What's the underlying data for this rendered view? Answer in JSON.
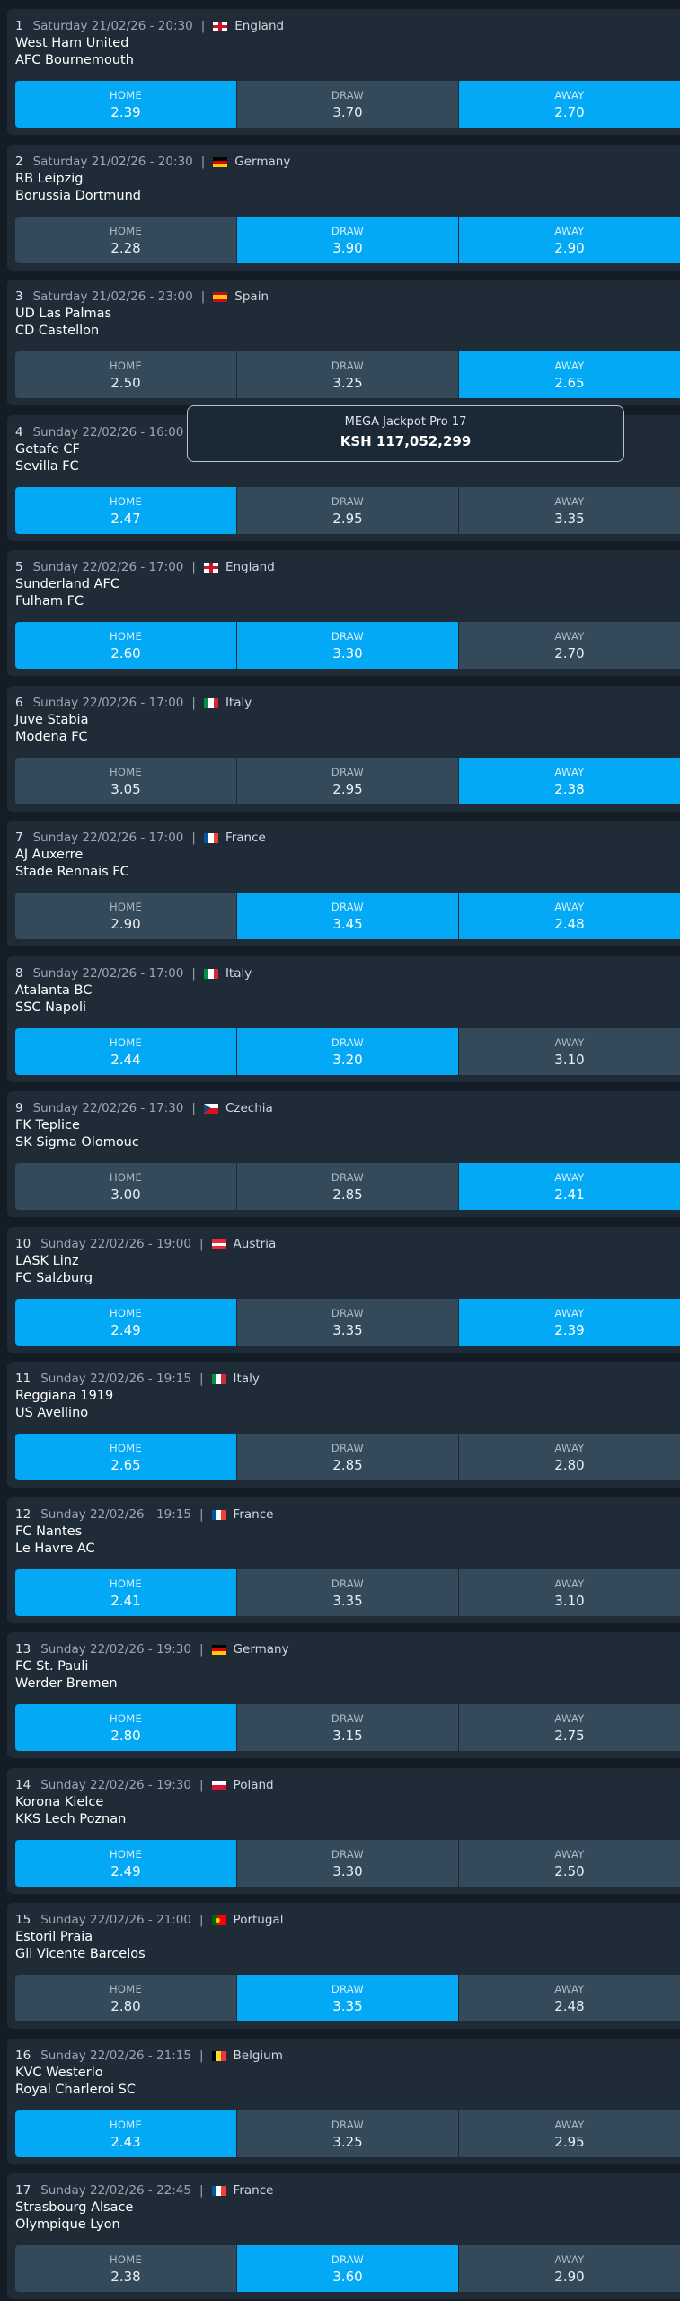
{
  "jackpot": {
    "title": "MEGA Jackpot Pro 17",
    "amount": "KSH 117,052,299"
  },
  "odds_labels": {
    "home": "HOME",
    "draw": "DRAW",
    "away": "AWAY"
  },
  "colors": {
    "selected": "#03a9f4",
    "unselected": "#34495a",
    "card": "#1f2c38",
    "background": "#141d26"
  },
  "matches": [
    {
      "num": "1",
      "date": "Saturday 21/02/26 - 20:30",
      "country": "England",
      "flag": "england-flag-icon",
      "home_team": "West Ham United",
      "away_team": "AFC Bournemouth",
      "odds": {
        "home": "2.39",
        "draw": "3.70",
        "away": "2.70"
      },
      "selected": [
        "home",
        "away"
      ]
    },
    {
      "num": "2",
      "date": "Saturday 21/02/26 - 20:30",
      "country": "Germany",
      "flag": "germany-flag-icon",
      "home_team": "RB Leipzig",
      "away_team": "Borussia Dortmund",
      "odds": {
        "home": "2.28",
        "draw": "3.90",
        "away": "2.90"
      },
      "selected": [
        "draw",
        "away"
      ]
    },
    {
      "num": "3",
      "date": "Saturday 21/02/26 - 23:00",
      "country": "Spain",
      "flag": "spain-flag-icon",
      "home_team": "UD Las Palmas",
      "away_team": "CD Castellon",
      "odds": {
        "home": "2.50",
        "draw": "3.25",
        "away": "2.65"
      },
      "selected": [
        "away"
      ]
    },
    {
      "num": "4",
      "date": "Sunday 22/02/26 - 16:00",
      "country": "",
      "flag": "",
      "home_team": "Getafe CF",
      "away_team": "Sevilla FC",
      "odds": {
        "home": "2.47",
        "draw": "2.95",
        "away": "3.35"
      },
      "selected": [
        "home"
      ]
    },
    {
      "num": "5",
      "date": "Sunday 22/02/26 - 17:00",
      "country": "England",
      "flag": "england-flag-icon",
      "home_team": "Sunderland AFC",
      "away_team": "Fulham FC",
      "odds": {
        "home": "2.60",
        "draw": "3.30",
        "away": "2.70"
      },
      "selected": [
        "home",
        "draw"
      ]
    },
    {
      "num": "6",
      "date": "Sunday 22/02/26 - 17:00",
      "country": "Italy",
      "flag": "italy-flag-icon",
      "home_team": "Juve Stabia",
      "away_team": "Modena FC",
      "odds": {
        "home": "3.05",
        "draw": "2.95",
        "away": "2.38"
      },
      "selected": [
        "away"
      ]
    },
    {
      "num": "7",
      "date": "Sunday 22/02/26 - 17:00",
      "country": "France",
      "flag": "france-flag-icon",
      "home_team": "AJ Auxerre",
      "away_team": "Stade Rennais FC",
      "odds": {
        "home": "2.90",
        "draw": "3.45",
        "away": "2.48"
      },
      "selected": [
        "draw",
        "away"
      ]
    },
    {
      "num": "8",
      "date": "Sunday 22/02/26 - 17:00",
      "country": "Italy",
      "flag": "italy-flag-icon",
      "home_team": "Atalanta BC",
      "away_team": "SSC Napoli",
      "odds": {
        "home": "2.44",
        "draw": "3.20",
        "away": "3.10"
      },
      "selected": [
        "home",
        "draw"
      ]
    },
    {
      "num": "9",
      "date": "Sunday 22/02/26 - 17:30",
      "country": "Czechia",
      "flag": "czechia-flag-icon",
      "home_team": "FK Teplice",
      "away_team": "SK Sigma Olomouc",
      "odds": {
        "home": "3.00",
        "draw": "2.85",
        "away": "2.41"
      },
      "selected": [
        "away"
      ]
    },
    {
      "num": "10",
      "date": "Sunday 22/02/26 - 19:00",
      "country": "Austria",
      "flag": "austria-flag-icon",
      "home_team": "LASK Linz",
      "away_team": "FC Salzburg",
      "odds": {
        "home": "2.49",
        "draw": "3.35",
        "away": "2.39"
      },
      "selected": [
        "home",
        "away"
      ]
    },
    {
      "num": "11",
      "date": "Sunday 22/02/26 - 19:15",
      "country": "Italy",
      "flag": "italy-flag-icon",
      "home_team": "Reggiana 1919",
      "away_team": "US Avellino",
      "odds": {
        "home": "2.65",
        "draw": "2.85",
        "away": "2.80"
      },
      "selected": [
        "home"
      ]
    },
    {
      "num": "12",
      "date": "Sunday 22/02/26 - 19:15",
      "country": "France",
      "flag": "france-flag-icon",
      "home_team": "FC Nantes",
      "away_team": "Le Havre AC",
      "odds": {
        "home": "2.41",
        "draw": "3.35",
        "away": "3.10"
      },
      "selected": [
        "home"
      ]
    },
    {
      "num": "13",
      "date": "Sunday 22/02/26 - 19:30",
      "country": "Germany",
      "flag": "germany-flag-icon",
      "home_team": "FC St. Pauli",
      "away_team": "Werder Bremen",
      "odds": {
        "home": "2.80",
        "draw": "3.15",
        "away": "2.75"
      },
      "selected": [
        "home"
      ]
    },
    {
      "num": "14",
      "date": "Sunday 22/02/26 - 19:30",
      "country": "Poland",
      "flag": "poland-flag-icon",
      "home_team": "Korona Kielce",
      "away_team": "KKS Lech Poznan",
      "odds": {
        "home": "2.49",
        "draw": "3.30",
        "away": "2.50"
      },
      "selected": [
        "home"
      ]
    },
    {
      "num": "15",
      "date": "Sunday 22/02/26 - 21:00",
      "country": "Portugal",
      "flag": "portugal-flag-icon",
      "home_team": "Estoril Praia",
      "away_team": "Gil Vicente Barcelos",
      "odds": {
        "home": "2.80",
        "draw": "3.35",
        "away": "2.48"
      },
      "selected": [
        "draw"
      ]
    },
    {
      "num": "16",
      "date": "Sunday 22/02/26 - 21:15",
      "country": "Belgium",
      "flag": "belgium-flag-icon",
      "home_team": "KVC Westerlo",
      "away_team": "Royal Charleroi SC",
      "odds": {
        "home": "2.43",
        "draw": "3.25",
        "away": "2.95"
      },
      "selected": [
        "home"
      ]
    },
    {
      "num": "17",
      "date": "Sunday 22/02/26 - 22:45",
      "country": "France",
      "flag": "france-flag-icon",
      "home_team": "Strasbourg Alsace",
      "away_team": "Olympique Lyon",
      "odds": {
        "home": "2.38",
        "draw": "3.60",
        "away": "2.90"
      },
      "selected": [
        "draw"
      ]
    }
  ]
}
